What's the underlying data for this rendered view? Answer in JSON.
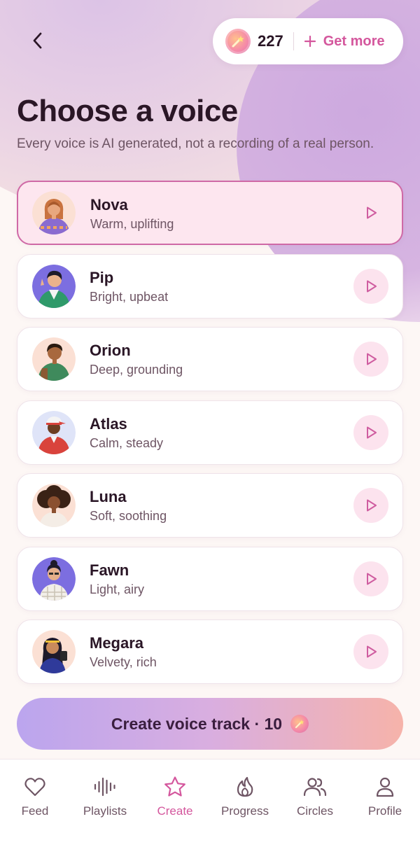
{
  "header": {
    "coin_count": "227",
    "get_more_label": "Get more"
  },
  "page": {
    "title": "Choose a voice",
    "subtitle": "Every voice is AI generated, not a recording of a real person."
  },
  "voices": [
    {
      "name": "Nova",
      "description": "Warm, uplifting",
      "selected": true
    },
    {
      "name": "Pip",
      "description": "Bright, upbeat",
      "selected": false
    },
    {
      "name": "Orion",
      "description": "Deep, grounding",
      "selected": false
    },
    {
      "name": "Atlas",
      "description": "Calm, steady",
      "selected": false
    },
    {
      "name": "Luna",
      "description": "Soft, soothing",
      "selected": false
    },
    {
      "name": "Fawn",
      "description": "Light, airy",
      "selected": false
    },
    {
      "name": "Megara",
      "description": "Velvety, rich",
      "selected": false
    }
  ],
  "create_button": {
    "label": "Create voice track · 10"
  },
  "tabs": [
    {
      "label": "Feed",
      "icon": "heart-icon",
      "active": false
    },
    {
      "label": "Playlists",
      "icon": "audio-wave-icon",
      "active": false
    },
    {
      "label": "Create",
      "icon": "star-icon",
      "active": true
    },
    {
      "label": "Progress",
      "icon": "flame-icon",
      "active": false
    },
    {
      "label": "Circles",
      "icon": "people-icon",
      "active": false
    },
    {
      "label": "Profile",
      "icon": "person-icon",
      "active": false
    }
  ],
  "colors": {
    "accent": "#d4579d",
    "selected_card_bg": "#fde6ef",
    "selected_card_border": "#cf69a6",
    "text_primary": "#2a1626",
    "text_secondary": "#6e5564"
  }
}
